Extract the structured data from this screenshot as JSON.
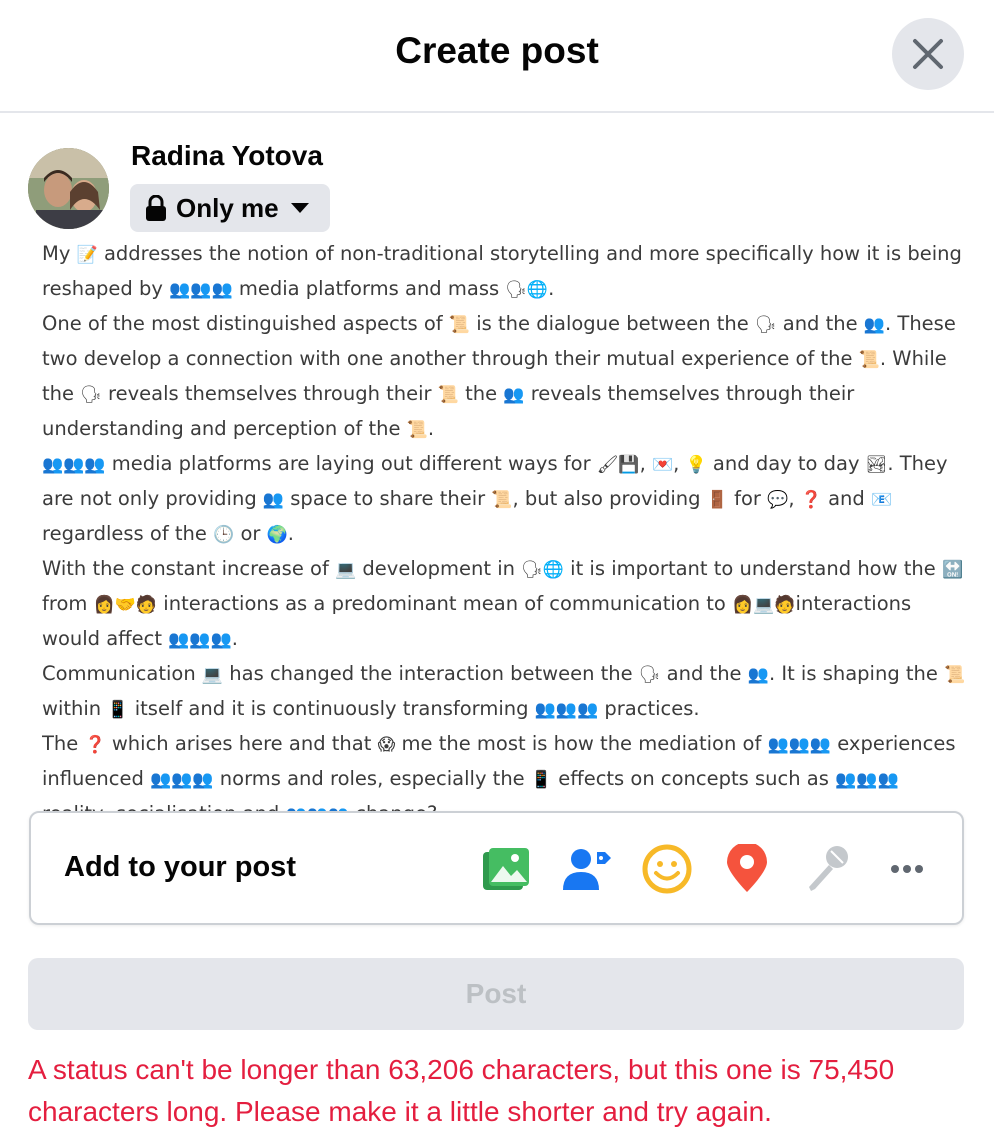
{
  "header": {
    "title": "Create post"
  },
  "author": {
    "name": "Radina Yotova"
  },
  "privacy": {
    "label": "Only me"
  },
  "post_text": {
    "lines": [
      [
        "My ",
        "📝",
        " addresses the notion of non-traditional storytelling and more specifically how it is being reshaped by ",
        "👥👥👥",
        " media platforms and mass ",
        "🗣🌐",
        "."
      ],
      [
        "One of the most distinguished aspects of ",
        "📜",
        " is the dialogue between the ",
        "🗣",
        " and the ",
        "👥",
        ". These two develop a connection with one another through their mutual experience of the ",
        "📜",
        ". While the ",
        "🗣",
        " reveals themselves through their ",
        "📜",
        " the ",
        "👥",
        " reveals themselves through their understanding and perception of the ",
        "📜",
        "."
      ],
      [
        "👥👥👥",
        " media platforms are laying out different ways for ",
        "🖌💾",
        ", ",
        "💌",
        ", ",
        "💡",
        " and day to day ",
        "🏞",
        ". They are not only providing ",
        "👥",
        " space to share their ",
        "📜",
        ", but also providing ",
        "🚪",
        " for ",
        "💬",
        ", ",
        "❓",
        " and ",
        "📧",
        " regardless of the ",
        "🕒",
        " or ",
        "🌍",
        "."
      ],
      [
        "With the constant increase of ",
        "💻",
        " development in ",
        "🗣🌐",
        " it is important to understand how the ",
        "🔛",
        " from ",
        "👩🤝🧑",
        " interactions as a predominant mean of communication to ",
        "👩💻🧑",
        "interactions would affect ",
        "👥👥👥",
        "."
      ],
      [
        "Communication ",
        "💻",
        " has changed the interaction between the ",
        "🗣",
        " and the ",
        "👥",
        ". It is shaping the ",
        "📜",
        " within ",
        "📱",
        " itself and it is continuously transforming ",
        "👥👥👥",
        " practices."
      ],
      [
        "The ",
        "❓",
        " which arises here and that ",
        "😱",
        " me the most is how the mediation of ",
        "👥👥👥",
        " experiences influenced ",
        "👥👥👥",
        " norms and roles, especially the ",
        "📱",
        " effects on concepts such as ",
        "👥👥👥",
        " reality, socialisation and ",
        "👥👥👥",
        " change?"
      ]
    ]
  },
  "add_to_post": {
    "label": "Add to your post",
    "tools": [
      "photo-video-icon",
      "tag-people-icon",
      "feeling-icon",
      "check-in-icon",
      "live-video-icon",
      "more-icon"
    ],
    "colors": {
      "photo": "#45bd62",
      "tag": "#1877f2",
      "feeling": "#f7b928",
      "checkin": "#f5533d",
      "disabled": "#bcc0c4"
    }
  },
  "post_button": {
    "label": "Post"
  },
  "error": {
    "message": "A status can't be longer than 63,206 characters, but this one is 75,450 characters long. Please make it a little shorter and try again.",
    "color": "#e41e3f"
  }
}
